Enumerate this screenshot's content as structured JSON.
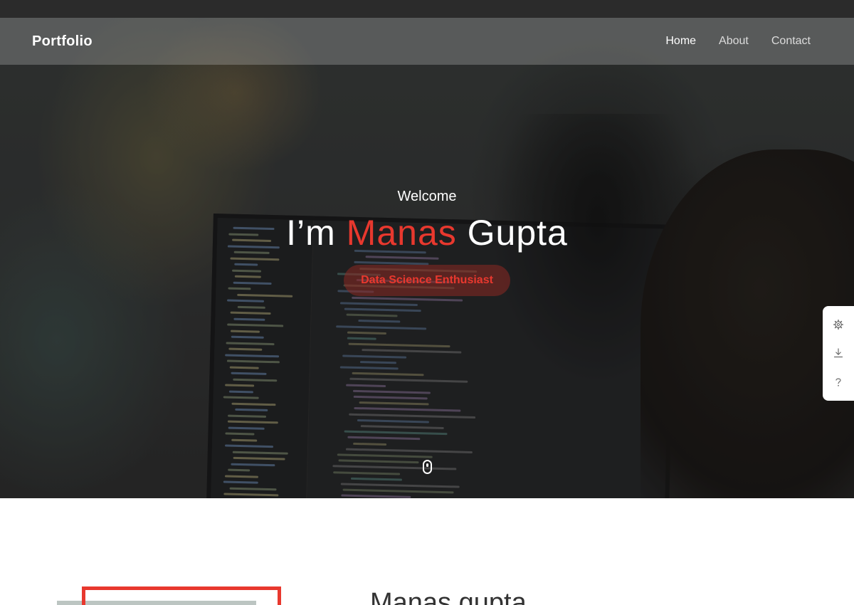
{
  "navbar": {
    "brand": "Portfolio",
    "links": [
      {
        "label": "Home",
        "active": true
      },
      {
        "label": "About",
        "active": false
      },
      {
        "label": "Contact",
        "active": false
      }
    ]
  },
  "hero": {
    "welcome": "Welcome",
    "headline_prefix": "I’m ",
    "headline_highlight": "Manas",
    "headline_suffix": " Gupta",
    "tagline": "Data Science Enthusiast",
    "scroll_icon": "mouse-scroll-icon"
  },
  "side_panel": {
    "icons": [
      "gear-icon",
      "download-icon",
      "help-icon"
    ]
  },
  "about": {
    "name": "Manas gupta"
  },
  "colors": {
    "accent": "#e8382e",
    "topbar": "#2b2b2b",
    "text_light": "#ffffff"
  }
}
